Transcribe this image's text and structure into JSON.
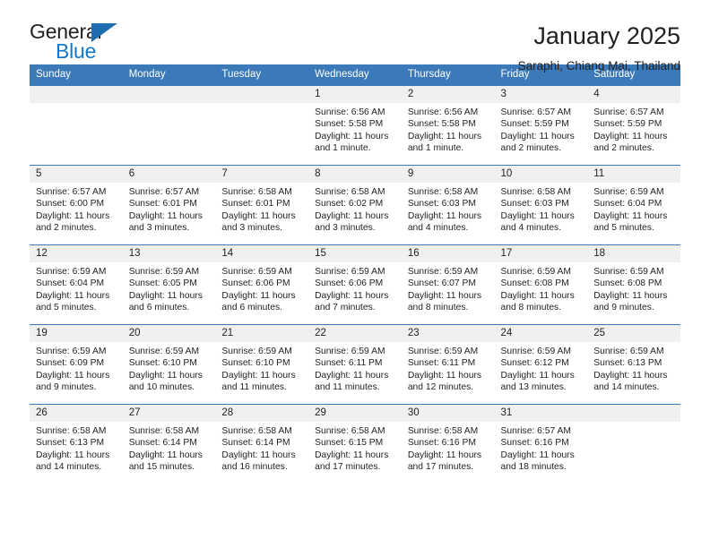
{
  "brand": {
    "word_one": "General",
    "word_two": "Blue",
    "triangle_color": "#1f6cb0",
    "blue_color": "#1676c8"
  },
  "header": {
    "title": "January 2025",
    "location": "Saraphi, Chiang Mai, Thailand"
  },
  "theme": {
    "header_row_color": "#3b79b8",
    "daynum_band_color": "#f0f0f0",
    "text_color": "#231f20"
  },
  "calendar": {
    "weekday_headers": [
      "Sunday",
      "Monday",
      "Tuesday",
      "Wednesday",
      "Thursday",
      "Friday",
      "Saturday"
    ],
    "weeks": [
      [
        {
          "day": "",
          "lines": []
        },
        {
          "day": "",
          "lines": []
        },
        {
          "day": "",
          "lines": []
        },
        {
          "day": "1",
          "lines": [
            "Sunrise: 6:56 AM",
            "Sunset: 5:58 PM",
            "Daylight: 11 hours",
            "and 1 minute."
          ]
        },
        {
          "day": "2",
          "lines": [
            "Sunrise: 6:56 AM",
            "Sunset: 5:58 PM",
            "Daylight: 11 hours",
            "and 1 minute."
          ]
        },
        {
          "day": "3",
          "lines": [
            "Sunrise: 6:57 AM",
            "Sunset: 5:59 PM",
            "Daylight: 11 hours",
            "and 2 minutes."
          ]
        },
        {
          "day": "4",
          "lines": [
            "Sunrise: 6:57 AM",
            "Sunset: 5:59 PM",
            "Daylight: 11 hours",
            "and 2 minutes."
          ]
        }
      ],
      [
        {
          "day": "5",
          "lines": [
            "Sunrise: 6:57 AM",
            "Sunset: 6:00 PM",
            "Daylight: 11 hours",
            "and 2 minutes."
          ]
        },
        {
          "day": "6",
          "lines": [
            "Sunrise: 6:57 AM",
            "Sunset: 6:01 PM",
            "Daylight: 11 hours",
            "and 3 minutes."
          ]
        },
        {
          "day": "7",
          "lines": [
            "Sunrise: 6:58 AM",
            "Sunset: 6:01 PM",
            "Daylight: 11 hours",
            "and 3 minutes."
          ]
        },
        {
          "day": "8",
          "lines": [
            "Sunrise: 6:58 AM",
            "Sunset: 6:02 PM",
            "Daylight: 11 hours",
            "and 3 minutes."
          ]
        },
        {
          "day": "9",
          "lines": [
            "Sunrise: 6:58 AM",
            "Sunset: 6:03 PM",
            "Daylight: 11 hours",
            "and 4 minutes."
          ]
        },
        {
          "day": "10",
          "lines": [
            "Sunrise: 6:58 AM",
            "Sunset: 6:03 PM",
            "Daylight: 11 hours",
            "and 4 minutes."
          ]
        },
        {
          "day": "11",
          "lines": [
            "Sunrise: 6:59 AM",
            "Sunset: 6:04 PM",
            "Daylight: 11 hours",
            "and 5 minutes."
          ]
        }
      ],
      [
        {
          "day": "12",
          "lines": [
            "Sunrise: 6:59 AM",
            "Sunset: 6:04 PM",
            "Daylight: 11 hours",
            "and 5 minutes."
          ]
        },
        {
          "day": "13",
          "lines": [
            "Sunrise: 6:59 AM",
            "Sunset: 6:05 PM",
            "Daylight: 11 hours",
            "and 6 minutes."
          ]
        },
        {
          "day": "14",
          "lines": [
            "Sunrise: 6:59 AM",
            "Sunset: 6:06 PM",
            "Daylight: 11 hours",
            "and 6 minutes."
          ]
        },
        {
          "day": "15",
          "lines": [
            "Sunrise: 6:59 AM",
            "Sunset: 6:06 PM",
            "Daylight: 11 hours",
            "and 7 minutes."
          ]
        },
        {
          "day": "16",
          "lines": [
            "Sunrise: 6:59 AM",
            "Sunset: 6:07 PM",
            "Daylight: 11 hours",
            "and 8 minutes."
          ]
        },
        {
          "day": "17",
          "lines": [
            "Sunrise: 6:59 AM",
            "Sunset: 6:08 PM",
            "Daylight: 11 hours",
            "and 8 minutes."
          ]
        },
        {
          "day": "18",
          "lines": [
            "Sunrise: 6:59 AM",
            "Sunset: 6:08 PM",
            "Daylight: 11 hours",
            "and 9 minutes."
          ]
        }
      ],
      [
        {
          "day": "19",
          "lines": [
            "Sunrise: 6:59 AM",
            "Sunset: 6:09 PM",
            "Daylight: 11 hours",
            "and 9 minutes."
          ]
        },
        {
          "day": "20",
          "lines": [
            "Sunrise: 6:59 AM",
            "Sunset: 6:10 PM",
            "Daylight: 11 hours",
            "and 10 minutes."
          ]
        },
        {
          "day": "21",
          "lines": [
            "Sunrise: 6:59 AM",
            "Sunset: 6:10 PM",
            "Daylight: 11 hours",
            "and 11 minutes."
          ]
        },
        {
          "day": "22",
          "lines": [
            "Sunrise: 6:59 AM",
            "Sunset: 6:11 PM",
            "Daylight: 11 hours",
            "and 11 minutes."
          ]
        },
        {
          "day": "23",
          "lines": [
            "Sunrise: 6:59 AM",
            "Sunset: 6:11 PM",
            "Daylight: 11 hours",
            "and 12 minutes."
          ]
        },
        {
          "day": "24",
          "lines": [
            "Sunrise: 6:59 AM",
            "Sunset: 6:12 PM",
            "Daylight: 11 hours",
            "and 13 minutes."
          ]
        },
        {
          "day": "25",
          "lines": [
            "Sunrise: 6:59 AM",
            "Sunset: 6:13 PM",
            "Daylight: 11 hours",
            "and 14 minutes."
          ]
        }
      ],
      [
        {
          "day": "26",
          "lines": [
            "Sunrise: 6:58 AM",
            "Sunset: 6:13 PM",
            "Daylight: 11 hours",
            "and 14 minutes."
          ]
        },
        {
          "day": "27",
          "lines": [
            "Sunrise: 6:58 AM",
            "Sunset: 6:14 PM",
            "Daylight: 11 hours",
            "and 15 minutes."
          ]
        },
        {
          "day": "28",
          "lines": [
            "Sunrise: 6:58 AM",
            "Sunset: 6:14 PM",
            "Daylight: 11 hours",
            "and 16 minutes."
          ]
        },
        {
          "day": "29",
          "lines": [
            "Sunrise: 6:58 AM",
            "Sunset: 6:15 PM",
            "Daylight: 11 hours",
            "and 17 minutes."
          ]
        },
        {
          "day": "30",
          "lines": [
            "Sunrise: 6:58 AM",
            "Sunset: 6:16 PM",
            "Daylight: 11 hours",
            "and 17 minutes."
          ]
        },
        {
          "day": "31",
          "lines": [
            "Sunrise: 6:57 AM",
            "Sunset: 6:16 PM",
            "Daylight: 11 hours",
            "and 18 minutes."
          ]
        },
        {
          "day": "",
          "lines": []
        }
      ]
    ]
  }
}
